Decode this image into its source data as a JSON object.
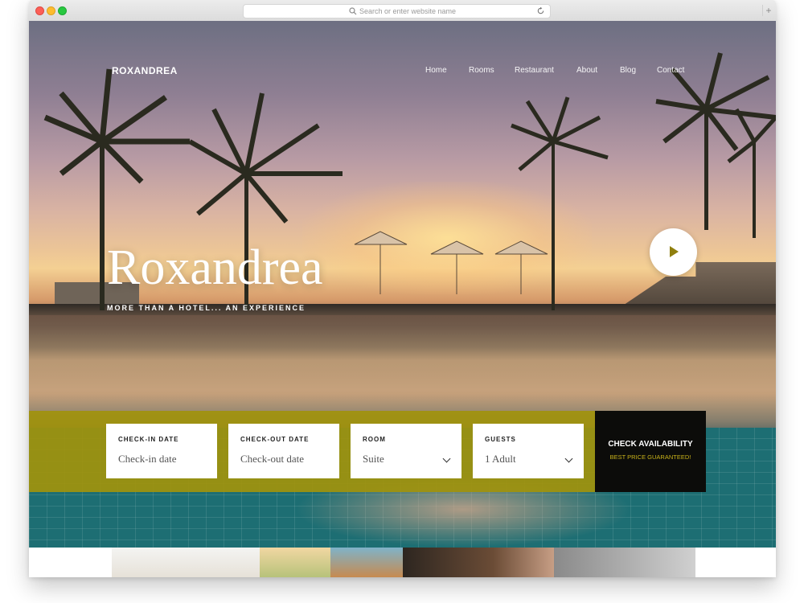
{
  "browser": {
    "url_placeholder": "Search or enter website name",
    "new_tab_label": "+"
  },
  "site": {
    "logo": "ROXANDREA",
    "nav": [
      "Home",
      "Rooms",
      "Restaurant",
      "About",
      "Blog",
      "Contact"
    ],
    "hero": {
      "title": "Roxandrea",
      "subtitle": "MORE THAN A HOTEL... AN EXPERIENCE"
    },
    "booking": {
      "fields": [
        {
          "label": "CHECK-IN DATE",
          "value": "Check-in date"
        },
        {
          "label": "CHECK-OUT DATE",
          "value": "Check-out date"
        },
        {
          "label": "ROOM",
          "value": "Suite"
        },
        {
          "label": "GUESTS",
          "value": "1 Adult"
        }
      ],
      "button_label": "CHECK AVAILABILITY",
      "button_sublabel": "BEST PRICE GUARANTEED!"
    }
  },
  "colors": {
    "accent_gold": "#a1920c",
    "button_dark": "#0c0c0a",
    "subtext_gold": "#c9b21a"
  },
  "icons": [
    "search-icon",
    "reload-icon",
    "play-icon",
    "chevron-down-icon"
  ]
}
